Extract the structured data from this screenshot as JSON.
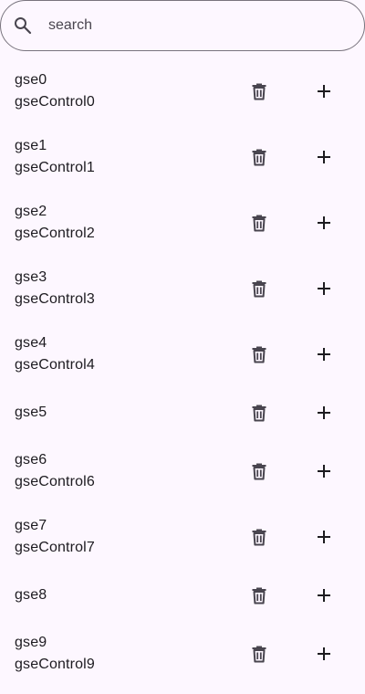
{
  "search": {
    "placeholder": "search",
    "icon": "search-icon"
  },
  "icons": {
    "delete": "trash-icon",
    "add": "plus-icon"
  },
  "items": [
    {
      "title": "gse0",
      "subtitle": "gseControl0"
    },
    {
      "title": "gse1",
      "subtitle": "gseControl1"
    },
    {
      "title": "gse2",
      "subtitle": "gseControl2"
    },
    {
      "title": "gse3",
      "subtitle": "gseControl3"
    },
    {
      "title": "gse4",
      "subtitle": "gseControl4"
    },
    {
      "title": "gse5",
      "subtitle": ""
    },
    {
      "title": "gse6",
      "subtitle": "gseControl6"
    },
    {
      "title": "gse7",
      "subtitle": "gseControl7"
    },
    {
      "title": "gse8",
      "subtitle": ""
    },
    {
      "title": "gse9",
      "subtitle": "gseControl9"
    }
  ]
}
